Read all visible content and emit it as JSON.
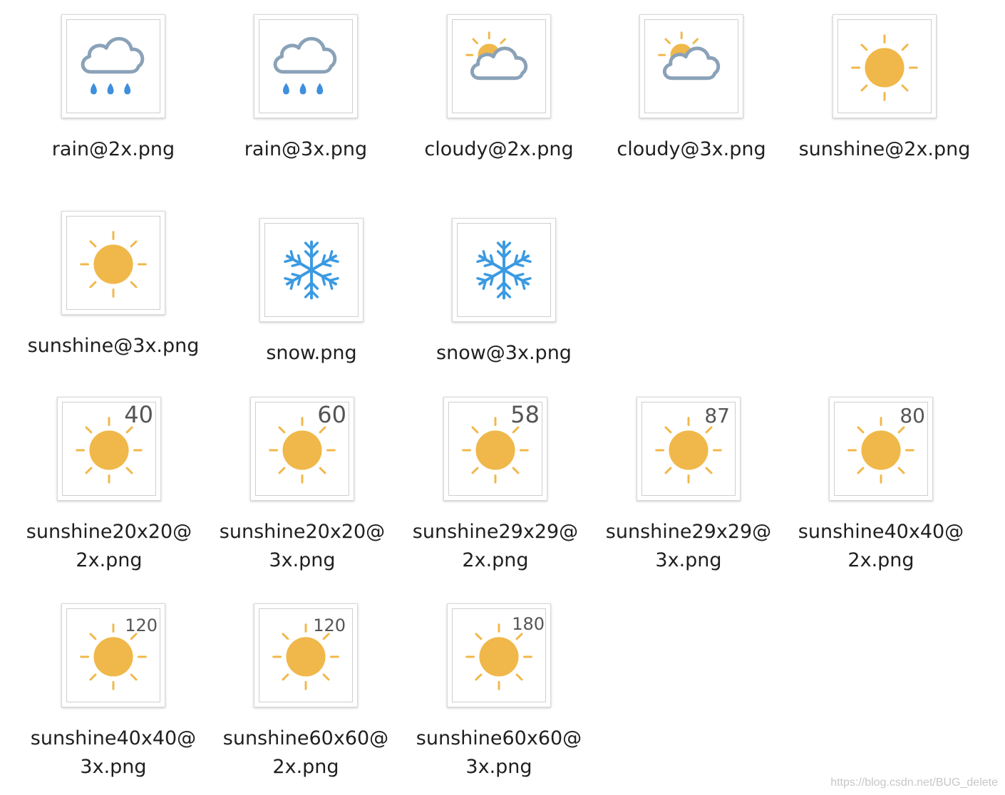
{
  "colors": {
    "sun": "#f0b84a",
    "cloud_stroke": "#8aa2b8",
    "rain_drop": "#3f8fdc",
    "snow": "#3b9ae1",
    "label_text": "#1f1f1f"
  },
  "files": [
    {
      "icon": "rain-icon",
      "label_lines": [
        "rain@2x.png"
      ]
    },
    {
      "icon": "rain-icon",
      "label_lines": [
        "rain@3x.png"
      ]
    },
    {
      "icon": "cloudy-icon",
      "label_lines": [
        "cloudy@2x.png"
      ]
    },
    {
      "icon": "cloudy-icon",
      "label_lines": [
        "cloudy@3x.png"
      ]
    },
    {
      "icon": "sun-icon",
      "label_lines": [
        "sunshine@2x.png"
      ]
    },
    {
      "icon": "sun-icon",
      "label_lines": [
        "sunshine@3x.png"
      ]
    },
    {
      "icon": "snowflake-icon",
      "label_lines": [
        "snow.png"
      ]
    },
    {
      "icon": "snowflake-icon",
      "label_lines": [
        "snow@3x.png"
      ]
    },
    {
      "icon": "sun-icon",
      "size_number": "40",
      "label_lines": [
        "sunshine20x20@",
        "2x.png"
      ]
    },
    {
      "icon": "sun-icon",
      "size_number": "60",
      "label_lines": [
        "sunshine20x20@",
        "3x.png"
      ]
    },
    {
      "icon": "sun-icon",
      "size_number": "58",
      "label_lines": [
        "sunshine29x29@",
        "2x.png"
      ]
    },
    {
      "icon": "sun-icon",
      "size_number": "87",
      "label_lines": [
        "sunshine29x29@",
        "3x.png"
      ]
    },
    {
      "icon": "sun-icon",
      "size_number": "80",
      "label_lines": [
        "sunshine40x40@",
        "2x.png"
      ]
    },
    {
      "icon": "sun-icon",
      "size_number": "120",
      "label_lines": [
        "sunshine40x40@",
        "3x.png"
      ]
    },
    {
      "icon": "sun-icon",
      "size_number": "120",
      "label_lines": [
        "sunshine60x60@",
        "2x.png"
      ]
    },
    {
      "icon": "sun-icon",
      "size_number": "180",
      "label_lines": [
        "sunshine60x60@",
        "3x.png"
      ]
    }
  ],
  "watermark": "https://blog.csdn.net/BUG_delete"
}
